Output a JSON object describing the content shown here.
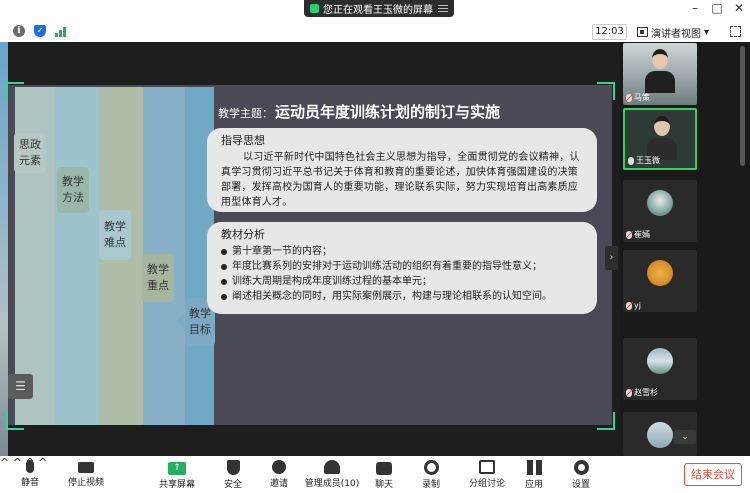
{
  "window": {
    "banner_text": "您正在观看王玉微的屏幕",
    "controls": {
      "minimize": "–",
      "maximize": "□",
      "close": "✕"
    }
  },
  "toolbar": {
    "time": "12:03",
    "view_label": "演讲者视图",
    "view_caret": "▾"
  },
  "slide": {
    "theme_label": "教学主题：",
    "theme_title": "运动员年度训练计划的制订与实施",
    "tabs": [
      {
        "line1": "思政",
        "line2": "元素"
      },
      {
        "line1": "教学",
        "line2": "方法"
      },
      {
        "line1": "教学",
        "line2": "难点"
      },
      {
        "line1": "教学",
        "line2": "重点"
      },
      {
        "line1": "教学",
        "line2": "目标"
      }
    ],
    "guiding": {
      "heading": "指导思想",
      "body": "以习近平新时代中国特色社会主义思想为指导，全面贯彻党的会议精神，认真学习贯彻习近平总书记关于体育和教育的重要论述，加快体育强国建设的决策部署，发挥高校为国育人的重要功能，理论联系实际，努力实现培育出高素质应用型体育人才。"
    },
    "analysis": {
      "heading": "教材分析",
      "items": [
        "第十章第一节的内容；",
        "年度比赛系列的安排对于运动训练活动的组织有着重要的指导性意义；",
        "训练大周期是构成年度训练过程的基本单元；",
        "阐述相关概念的同时，用实际案例展示，构建与理论相联系的认知空间。"
      ]
    }
  },
  "participants": [
    {
      "name": "马策"
    },
    {
      "name": "王玉微"
    },
    {
      "name": "崔嫣"
    },
    {
      "name": "yj"
    },
    {
      "name": "赵雪杉"
    }
  ],
  "bottom": {
    "mute": "静音",
    "stop_video": "停止视频",
    "share_screen": "共享屏幕",
    "security": "安全",
    "invite": "邀请",
    "members": "管理成员(10)",
    "chat": "聊天",
    "record": "录制",
    "breakout": "分组讨论",
    "apps": "应用",
    "settings": "设置",
    "end_meeting": "结束会议",
    "caret": "^"
  }
}
